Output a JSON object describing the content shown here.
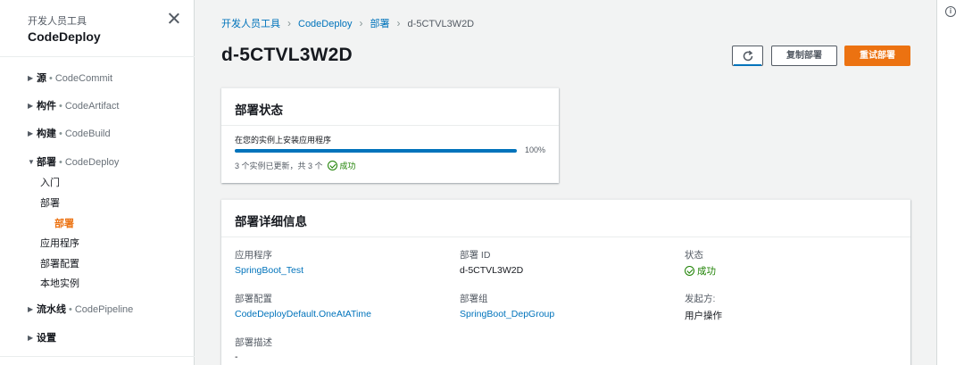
{
  "sidebar": {
    "super_title": "开发人员工具",
    "title": "CodeDeploy",
    "sections": [
      {
        "name": "源",
        "service": "CodeCommit"
      },
      {
        "name": "构件",
        "service": "CodeArtifact"
      },
      {
        "name": "构建",
        "service": "CodeBuild"
      },
      {
        "name": "部署",
        "service": "CodeDeploy"
      },
      {
        "name": "流水线",
        "service": "CodePipeline"
      },
      {
        "name": "设置",
        "service": ""
      }
    ],
    "sep": "•",
    "collapsed_marker": "▶",
    "expanded_marker": "▼",
    "deploy_items": [
      "入门",
      "部署",
      "部署",
      "应用程序",
      "部署配置",
      "本地实例"
    ]
  },
  "breadcrumb": {
    "items": [
      "开发人员工具",
      "CodeDeploy",
      "部署"
    ],
    "current": "d-5CTVL3W2D"
  },
  "page_title": "d-5CTVL3W2D",
  "buttons": {
    "copy": "复制部署",
    "retry": "重试部署"
  },
  "status_card": {
    "title": "部署状态",
    "progress_label": "在您的实例上安装应用程序",
    "progress_fraction": 1.0,
    "progress_text": "100%",
    "summary": "3 个实例已更新，共 3 个",
    "status": "成功"
  },
  "details_card": {
    "title": "部署详细信息",
    "app_key": "应用程序",
    "app_val": "SpringBoot_Test",
    "id_key": "部署 ID",
    "id_val": "d-5CTVL3W2D",
    "state_key": "状态",
    "state_val": "成功",
    "config_key": "部署配置",
    "config_val": "CodeDeployDefault.OneAtATime",
    "group_key": "部署组",
    "group_val": "SpringBoot_DepGroup",
    "initiator_key": "发起方:",
    "initiator_val": "用户操作",
    "desc_key": "部署描述",
    "desc_val": "-"
  },
  "colors": {
    "accent": "#ec7211",
    "link": "#0073bb",
    "success": "#1d8102"
  }
}
